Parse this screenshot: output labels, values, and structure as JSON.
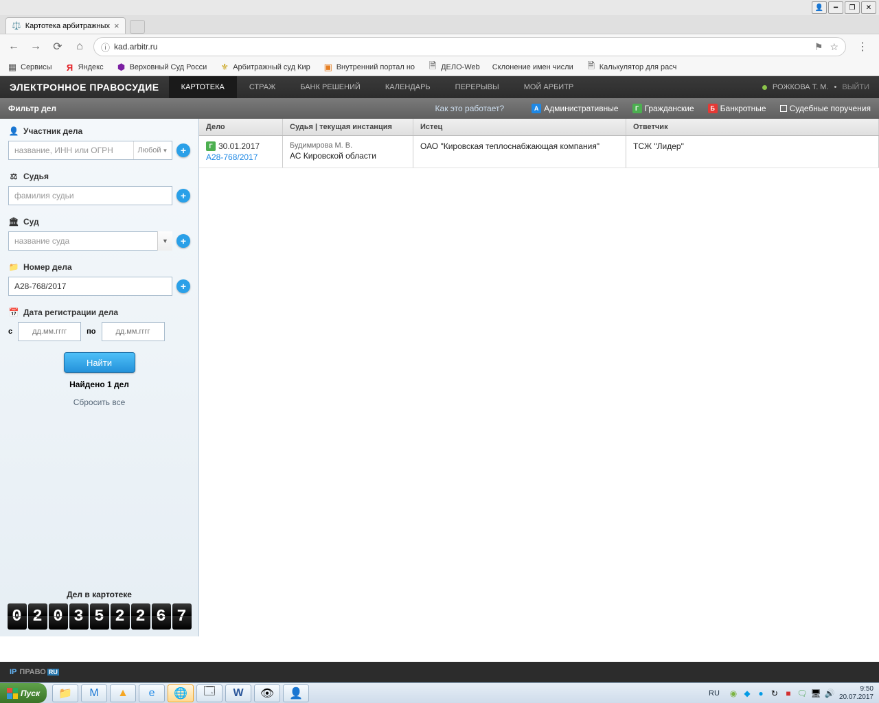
{
  "browser": {
    "tab_title": "Картотека арбитражных",
    "url": "kad.arbitr.ru",
    "bookmarks": [
      {
        "label": "Сервисы",
        "icon": "apps"
      },
      {
        "label": "Яндекс",
        "icon": "yandex"
      },
      {
        "label": "Верховный Суд Росси",
        "icon": "vs"
      },
      {
        "label": "Арбитражный суд Кир",
        "icon": "arb"
      },
      {
        "label": "Внутренний портал но",
        "icon": "portal"
      },
      {
        "label": "ДЕЛО-Web",
        "icon": "doc"
      },
      {
        "label": "Склонение имен числи",
        "icon": ""
      },
      {
        "label": "Калькулятор для расч",
        "icon": "doc"
      }
    ]
  },
  "app": {
    "title": "ЭЛЕКТРОННОЕ ПРАВОСУДИЕ",
    "nav": [
      "КАРТОТЕКА",
      "СТРАЖ",
      "БАНК РЕШЕНИЙ",
      "КАЛЕНДАРЬ",
      "ПЕРЕРЫВЫ",
      "МОЙ АРБИТР"
    ],
    "active_nav": 0,
    "user": "РОЖКОВА Т. М.",
    "logout": "ВЫЙТИ"
  },
  "toolbar": {
    "filter_title": "Фильтр дел",
    "how_link": "Как это работает?",
    "filters": [
      {
        "label": "Административные",
        "kind": "admin"
      },
      {
        "label": "Гражданские",
        "kind": "civil"
      },
      {
        "label": "Банкротные",
        "kind": "bank"
      },
      {
        "label": "Судебные поручения",
        "kind": "checkbox"
      }
    ]
  },
  "sidebar": {
    "participant": {
      "label": "Участник дела",
      "placeholder": "название, ИНН или ОГРН",
      "scope": "Любой"
    },
    "judge": {
      "label": "Судья",
      "placeholder": "фамилия судьи"
    },
    "court": {
      "label": "Суд",
      "placeholder": "название суда"
    },
    "case_no": {
      "label": "Номер дела",
      "value": "А28-768/2017"
    },
    "reg_date": {
      "label": "Дата регистрации дела",
      "from": "с",
      "to": "по",
      "ph": "дд.мм.гггг"
    },
    "search_btn": "Найти",
    "found": "Найдено 1 дел",
    "reset": "Сбросить все",
    "counter_label": "Дел в картотеке",
    "counter_digits": [
      "0",
      "2",
      "0",
      "3",
      "5",
      "2",
      "2",
      "6",
      "7"
    ]
  },
  "results": {
    "headers": {
      "case": "Дело",
      "judge": "Судья | текущая инстанция",
      "plaintiff": "Истец",
      "defendant": "Ответчик"
    },
    "rows": [
      {
        "date": "30.01.2017",
        "number": "А28-768/2017",
        "judge": "Будимирова М. В.",
        "court": "АС Кировской области",
        "plaintiff": "ОАО \"Кировская теплоснабжающая компания\"",
        "defendant": "ТСЖ \"Лидер\""
      }
    ]
  },
  "footer": {
    "logo_prefix": "ПРАВО",
    "logo_suffix": "RU"
  },
  "taskbar": {
    "start": "Пуск",
    "lang": "RU",
    "time": "9:50",
    "date": "20.07.2017"
  }
}
